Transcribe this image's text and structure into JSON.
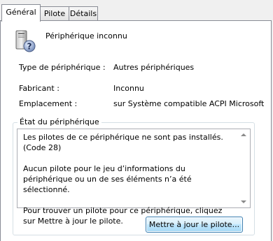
{
  "tabs": [
    {
      "label": "Général",
      "active": true
    },
    {
      "label": "Pilote",
      "active": false
    },
    {
      "label": "Détails",
      "active": false
    }
  ],
  "device": {
    "name": "Périphérique inconnu",
    "icon": "unknown-device-icon"
  },
  "properties": [
    {
      "label": "Type de périphérique :",
      "value": "Autres périphériques"
    },
    {
      "label": "Fabricant :",
      "value": "Inconnu"
    },
    {
      "label": "Emplacement :",
      "value": "sur Système compatible ACPI Microsoft"
    }
  ],
  "status": {
    "legend": "État du périphérique",
    "paragraphs": [
      "Les pilotes de ce périphérique ne sont pas installés. (Code 28)",
      "Aucun pilote pour le jeu d’informations du périphérique ou un de ses éléments n’a été sélectionné.",
      "Pour trouver un pilote pour ce périphérique, cliquez sur Mettre à jour le pilote."
    ]
  },
  "update_button": {
    "label": "Mettre à jour le pilote..."
  },
  "colors": {
    "accent_border": "#3c7fb1",
    "tab_border": "#898c95"
  }
}
